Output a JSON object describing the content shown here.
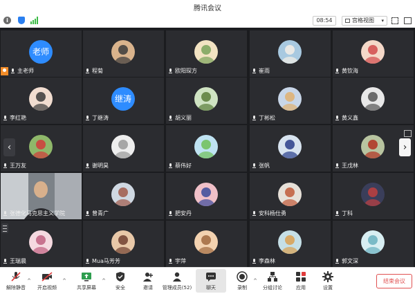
{
  "window": {
    "title": "腾讯会议"
  },
  "infobar": {
    "info_icon": "info-icon",
    "shield_icon": "shield-icon",
    "signal_icon": "signal-icon",
    "time": "08:54",
    "view_label": "宫格视图",
    "signal_color": "#3bbb45",
    "shield_color": "#2a7ff0"
  },
  "grid": {
    "participants": [
      {
        "name": "主老师",
        "avatar_text": "老师",
        "host": true
      },
      {
        "name": "程菊"
      },
      {
        "name": "欧阳琛方"
      },
      {
        "name": "崔雨"
      },
      {
        "name": "黄钦海"
      },
      {
        "name": "李红艳"
      },
      {
        "name": "丁继涛",
        "avatar_text": "继涛"
      },
      {
        "name": "胡义丽"
      },
      {
        "name": "丁彬松"
      },
      {
        "name": "黄义鑫"
      },
      {
        "name": "王万友"
      },
      {
        "name": "谢明昊"
      },
      {
        "name": "蔡伟好"
      },
      {
        "name": "张帆"
      },
      {
        "name": "王戊林"
      },
      {
        "name": "张德化马克思主义学院"
      },
      {
        "name": "曾青广"
      },
      {
        "name": "肥安丹"
      },
      {
        "name": "安科杨仕勇"
      },
      {
        "name": "丁科"
      },
      {
        "name": "王瑞晨"
      },
      {
        "name": "Mua马芳芳"
      },
      {
        "name": "宇萍"
      },
      {
        "name": "李森林"
      },
      {
        "name": "郭文深"
      }
    ],
    "nav_prev": "‹",
    "nav_next": "›",
    "avatar_color": "#2e8cff",
    "host_badge_color": "#f28c28"
  },
  "toolbar": {
    "items": [
      {
        "label": "解除静音",
        "icon": "muted-mic-icon"
      },
      {
        "label": "开启视频",
        "icon": "video-off-icon"
      },
      {
        "label": "共享屏幕",
        "icon": "share-screen-icon"
      },
      {
        "label": "安全",
        "icon": "security-shield-icon"
      },
      {
        "label": "邀请",
        "icon": "invite-icon"
      },
      {
        "label": "管理成员(52)",
        "icon": "members-icon"
      },
      {
        "label": "聊天",
        "icon": "chat-icon"
      },
      {
        "label": "录制",
        "icon": "record-icon"
      },
      {
        "label": "分组讨论",
        "icon": "breakout-icon"
      },
      {
        "label": "应用",
        "icon": "apps-icon"
      },
      {
        "label": "设置",
        "icon": "settings-gear-icon"
      }
    ],
    "end_label": "结束会议",
    "end_color": "#e05050"
  }
}
